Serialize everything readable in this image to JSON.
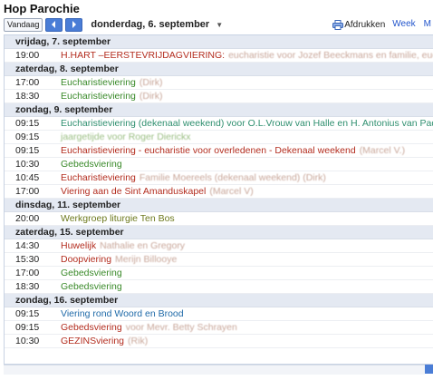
{
  "header": {
    "title": "Hop Parochie"
  },
  "toolbar": {
    "today_label": "Vandaag",
    "current_date": "donderdag, 6. september",
    "print_label": "Afdrukken",
    "tabs": [
      "Week",
      "M"
    ]
  },
  "days": [
    {
      "label": "vrijdag, 7. september",
      "events": [
        {
          "time": "19:00",
          "title": "H.HART –EERSTEVRIJDAGVIERING:",
          "extra": "eucharistie voor Jozef Beeckmans en familie, eucharistie voor A",
          "color": "red"
        }
      ]
    },
    {
      "label": "zaterdag, 8. september",
      "events": [
        {
          "time": "17:00",
          "title": "Eucharistieviering",
          "extra": "(Dirk)",
          "color": "green"
        },
        {
          "time": "18:30",
          "title": "Eucharistieviering",
          "extra": "(Dirk)",
          "color": "green"
        }
      ]
    },
    {
      "label": "zondag, 9. september",
      "events": [
        {
          "time": "09:15",
          "title": "Eucharistieviering (dekenaal weekend) voor O.L.Vrouw van Halle en H. Antonius van Padua uit dank",
          "extra": "(D",
          "color": "teal"
        },
        {
          "time": "09:15",
          "title": "",
          "extra": "jaargetijde voor Roger Dierickx",
          "color": "green"
        },
        {
          "time": "09:15",
          "title": "Eucharistieviering - eucharistie voor overledenen - Dekenaal weekend",
          "extra": "(Marcel V.)",
          "color": "red"
        },
        {
          "time": "10:30",
          "title": "Gebedsviering",
          "extra": "",
          "color": "green"
        },
        {
          "time": "10:45",
          "title": "Eucharistieviering",
          "extra": "Familie Moereels (dekenaal weekend) (Dirk)",
          "color": "red"
        },
        {
          "time": "17:00",
          "title": "Viering aan de Sint Amanduskapel",
          "extra": "(Marcel V)",
          "color": "red"
        }
      ]
    },
    {
      "label": "dinsdag, 11. september",
      "events": [
        {
          "time": "20:00",
          "title": "Werkgroep liturgie Ten Bos",
          "extra": "",
          "color": "olive"
        }
      ]
    },
    {
      "label": "zaterdag, 15. september",
      "events": [
        {
          "time": "14:30",
          "title": "Huwelijk",
          "extra": "Nathalie en Gregory",
          "color": "red"
        },
        {
          "time": "15:30",
          "title": "Doopviering",
          "extra": "Merijn Billooye",
          "color": "red"
        },
        {
          "time": "17:00",
          "title": "Gebedsviering",
          "extra": "",
          "color": "green"
        },
        {
          "time": "18:30",
          "title": "Gebedsviering",
          "extra": "",
          "color": "green"
        }
      ]
    },
    {
      "label": "zondag, 16. september",
      "events": [
        {
          "time": "09:15",
          "title": "Viering rond Woord en Brood",
          "extra": "",
          "color": "blue"
        },
        {
          "time": "09:15",
          "title": "Gebedsviering",
          "extra": "voor Mevr. Betty Schrayen",
          "color": "red"
        },
        {
          "time": "10:30",
          "title": "GEZINSviering",
          "extra": "(Rik)",
          "color": "red"
        }
      ]
    }
  ],
  "colors": {
    "accent": "#4a7dd6",
    "day_header_bg": "#e4e9f2",
    "link_blue": "#2255cc"
  },
  "icons": {
    "prev": "chevron-left-icon",
    "next": "chevron-right-icon",
    "print": "printer-icon",
    "dropdown": "caret-down-icon"
  }
}
